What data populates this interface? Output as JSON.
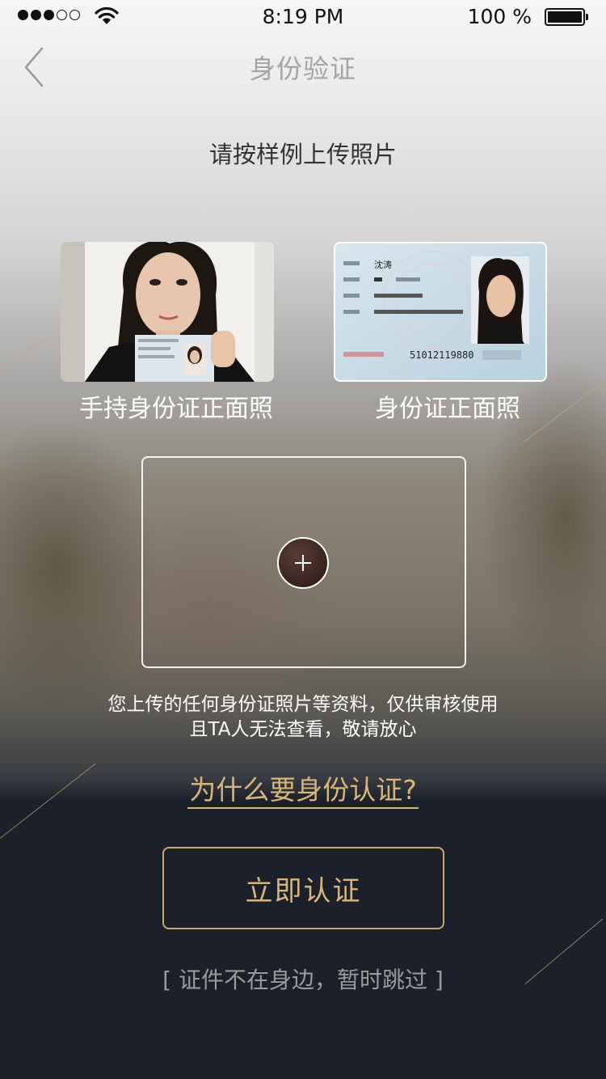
{
  "status_bar": {
    "signal_filled": 3,
    "signal_total": 5,
    "time": "8:19 PM",
    "battery_percent_text": "100 %",
    "battery_level": 1.0
  },
  "nav": {
    "back_icon": "chevron-left-icon",
    "title": "身份验证"
  },
  "instruction": "请按样例上传照片",
  "samples": [
    {
      "label": "手持身份证正面照",
      "icon": "handheld-id-photo"
    },
    {
      "label": "身份证正面照",
      "icon": "id-card-front-photo",
      "card_name": "沈涛",
      "card_number": "51012119880"
    }
  ],
  "upload": {
    "icon": "plus-icon"
  },
  "notice_lines": [
    "您上传的任何身份证照片等资料，仅供审核使用",
    "且TA人无法查看，敬请放心"
  ],
  "why_link": "为什么要身份认证?",
  "primary_button": "立即认证",
  "skip_link": "[ 证件不在身边，暂时跳过 ]",
  "colors": {
    "accent_gold": "#d8b67a",
    "dark_bg": "#1b1f2a"
  }
}
